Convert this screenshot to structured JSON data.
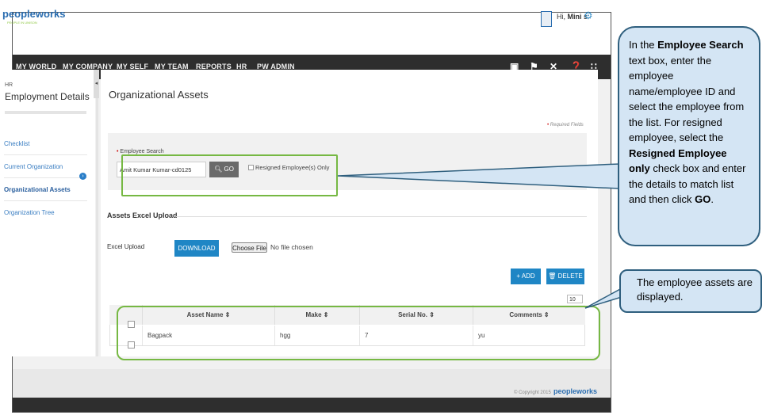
{
  "header": {
    "logo_text": "peopleworks",
    "tagline": "PEOPLE IN UNISON",
    "greeting": "Hi,",
    "user_name": "Mini s"
  },
  "nav": {
    "items": [
      "MY WORLD",
      "MY COMPANY",
      "MY SELF",
      "MY TEAM",
      "REPORTS",
      "HR",
      "PW ADMIN"
    ],
    "icons": [
      "book-icon",
      "flag-icon",
      "tools-icon",
      "help-icon",
      "share-icon"
    ]
  },
  "sidebar": {
    "section": "HR",
    "title": "Employment Details",
    "items": [
      "Checklist",
      "Current Organization",
      "Organizational Assets",
      "Organization Tree"
    ],
    "active_index": 2
  },
  "main": {
    "title": "Organizational Assets",
    "required_note": "Required Fields",
    "employee_search_label": "Employee Search",
    "employee_search_value": "Amit Kumar Kumar-cd0125",
    "go_label": "GO",
    "resigned_label": "Resigned Employee(s) Only",
    "assets_section": "Assets Excel Upload",
    "excel_label": "Excel Upload",
    "download_label": "DOWNLOAD",
    "choose_file_label": "Choose File",
    "no_file_label": "No file chosen",
    "add_label": "ADD",
    "delete_label": "DELETE",
    "show_value": "10",
    "table": {
      "columns": [
        "Asset Name",
        "Make",
        "Serial No.",
        "Comments"
      ],
      "rows": [
        [
          "Bagpack",
          "hgg",
          "7",
          "yu"
        ]
      ]
    }
  },
  "footer": {
    "copyright": "© Copyright 2015",
    "logo_text": "peopleworks"
  },
  "callouts": {
    "search_parts": [
      "In the ",
      "Employee Search",
      " text box, enter the employee name/employee ID and select the employee from the list. For resigned employee, select the ",
      "Resigned Employee only",
      " check box and enter the details to match list and then click ",
      "GO",
      "."
    ],
    "table_text": "The employee assets are displayed."
  },
  "colors": {
    "accent": "#1f86c5",
    "nav_bg": "#2e2e2e",
    "highlight": "#76b843",
    "callout_bg": "#d4e5f4"
  }
}
